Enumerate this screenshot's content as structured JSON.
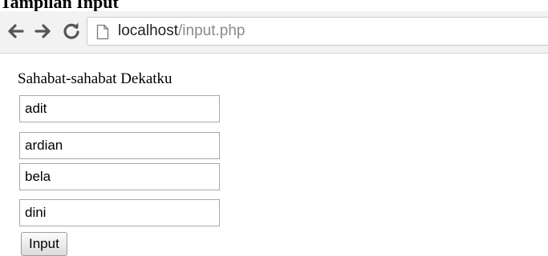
{
  "document": {
    "heading": "Tampilan Input"
  },
  "browser": {
    "url_host": "localhost",
    "url_path": "/input.php",
    "icons": {
      "back": "back-arrow-icon",
      "forward": "forward-arrow-icon",
      "reload": "reload-icon",
      "page": "page-icon"
    }
  },
  "form": {
    "label": "Sahabat-sahabat Dekatku",
    "fields": [
      "adit",
      "ardian",
      "bela",
      "dini"
    ],
    "submit_label": "Input"
  }
}
